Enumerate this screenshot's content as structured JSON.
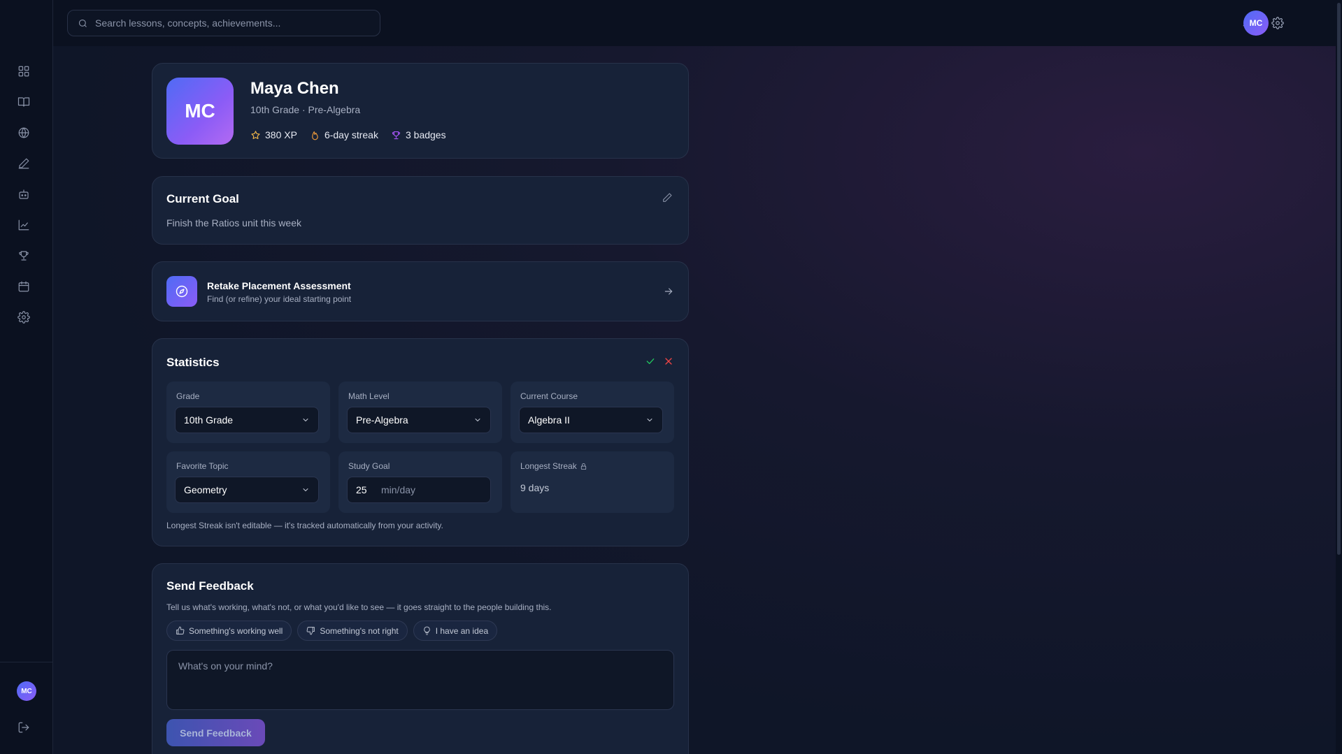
{
  "search": {
    "placeholder": "Search lessons, concepts, achievements..."
  },
  "user": {
    "initials": "MC"
  },
  "sidebar": {
    "items": [
      {
        "name": "dashboard",
        "icon": "grid-icon"
      },
      {
        "name": "lessons",
        "icon": "book-icon"
      },
      {
        "name": "explore",
        "icon": "globe-icon"
      },
      {
        "name": "practice",
        "icon": "pencil-icon"
      },
      {
        "name": "tutor",
        "icon": "robot-icon"
      },
      {
        "name": "progress",
        "icon": "chart-icon"
      },
      {
        "name": "achievements",
        "icon": "trophy-icon"
      },
      {
        "name": "calendar",
        "icon": "calendar-icon"
      },
      {
        "name": "settings",
        "icon": "gear-icon"
      }
    ]
  },
  "profile": {
    "initials": "MC",
    "name": "Maya Chen",
    "subtitle": "10th Grade · Pre-Algebra",
    "xp": "380 XP",
    "streak": "6-day streak",
    "badges": "3 badges"
  },
  "goal": {
    "title": "Current Goal",
    "text": "Finish the Ratios unit this week"
  },
  "retake": {
    "title": "Retake Placement Assessment",
    "subtitle": "Find (or refine) your ideal starting point"
  },
  "statistics": {
    "title": "Statistics",
    "grade_label": "Grade",
    "grade_value": "10th Grade",
    "math_level_label": "Math Level",
    "math_level_value": "Pre-Algebra",
    "course_label": "Current Course",
    "course_value": "Algebra II",
    "topic_label": "Favorite Topic",
    "topic_value": "Geometry",
    "study_goal_label": "Study Goal",
    "study_goal_value": "25",
    "study_goal_unit": "min/day",
    "longest_streak_label": "Longest Streak",
    "longest_streak_value": "9 days",
    "note": "Longest Streak isn't editable — it's tracked automatically from your activity."
  },
  "feedback": {
    "title": "Send Feedback",
    "subtitle": "Tell us what's working, what's not, or what you'd like to see — it goes straight to the people building this.",
    "chip_good": "Something's working well",
    "chip_bad": "Something's not right",
    "chip_idea": "I have an idea",
    "placeholder": "What's on your mind?",
    "button": "Send Feedback"
  },
  "colors": {
    "accent_start": "#4f6bf5",
    "accent_end": "#8b5cf6",
    "confirm": "#22c55e",
    "cancel": "#ef4444",
    "star": "#f5b94a",
    "fire": "#f59e3a",
    "trophy": "#a855f7"
  }
}
